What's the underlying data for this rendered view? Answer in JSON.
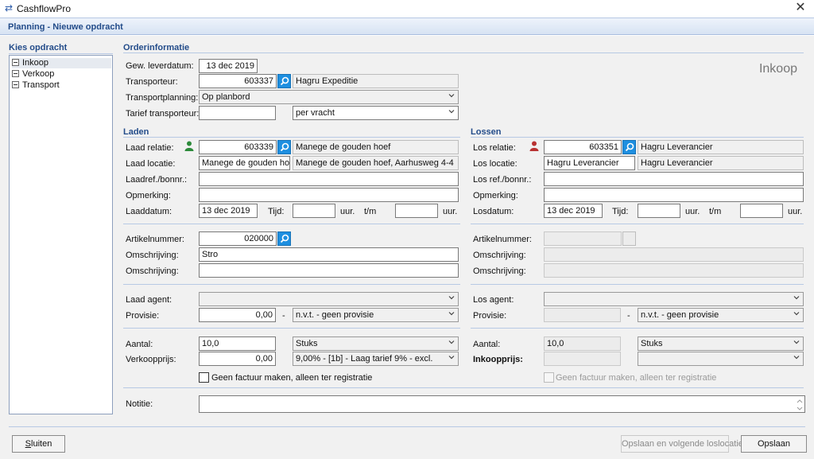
{
  "window": {
    "title": "CashflowPro",
    "subtitle": "Planning - Nieuwe opdracht"
  },
  "sidebar": {
    "title": "Kies opdracht",
    "items": [
      "Inkoop",
      "Verkoop",
      "Transport"
    ]
  },
  "order": {
    "title": "Orderinformatie",
    "type_label": "Inkoop",
    "leverdatum_label": "Gew. leverdatum:",
    "leverdatum": "13 dec 2019",
    "transporteur_label": "Transporteur:",
    "transporteur_code": "603337",
    "transporteur_naam": "Hagru Expeditie",
    "transportplanning_label": "Transportplanning:",
    "transportplanning": "Op planbord",
    "tarief_label": "Tarief transporteur:",
    "tarief_type": "per vracht"
  },
  "laden": {
    "title": "Laden",
    "relatie_label": "Laad relatie:",
    "relatie_code": "603339",
    "relatie_naam": "Manege de gouden hoef",
    "locatie_label": "Laad locatie:",
    "locatie": "Manege de gouden hoef",
    "locatie_adres": "Manege de gouden hoef, Aarhusweg 4-4",
    "ref_label": "Laadref./bonnr.:",
    "opmerking_label": "Opmerking:",
    "datum_label": "Laaddatum:",
    "datum": "13 dec 2019",
    "tijd_label": "Tijd:",
    "uur_label": "uur.",
    "tm_label": "t/m"
  },
  "lossen": {
    "title": "Lossen",
    "relatie_label": "Los relatie:",
    "relatie_code": "603351",
    "relatie_naam": "Hagru Leverancier",
    "locatie_label": "Los locatie:",
    "locatie": "Hagru Leverancier",
    "locatie_adres": "Hagru Leverancier",
    "ref_label": "Los ref./bonnr.:",
    "opmerking_label": "Opmerking:",
    "datum_label": "Losdatum:",
    "datum": "13 dec 2019",
    "tijd_label": "Tijd:",
    "uur_label": "uur.",
    "tm_label": "t/m"
  },
  "artikel": {
    "nummer_label": "Artikelnummer:",
    "nummer": "020000",
    "omschrijving_label": "Omschrijving:",
    "omschrijving": "Stro"
  },
  "agent": {
    "laad_label": "Laad agent:",
    "los_label": "Los agent:",
    "provisie_label": "Provisie:",
    "laad_provisie": "0,00",
    "dash": "-",
    "laad_provisie_type": "n.v.t. - geen provisie",
    "los_provisie_type": "n.v.t. - geen provisie"
  },
  "prijs": {
    "aantal_label": "Aantal:",
    "aantal": "10,0",
    "eenheid": "Stuks",
    "verkoopprijs_label": "Verkoopprijs:",
    "verkoopprijs": "0,00",
    "btw": "9,00% - [1b] - Laag tarief 9% - excl.",
    "inkoopprijs_label": "Inkoopprijs:",
    "geen_factuur_label": "Geen factuur maken, alleen ter registratie"
  },
  "notitie": {
    "label": "Notitie:"
  },
  "footer": {
    "sluiten_first": "S",
    "sluiten_rest": "luiten",
    "opslaan_volgende": "Opslaan en volgende loslocatie",
    "opslaan": "Opslaan"
  },
  "colors": {
    "header_text": "#234c8a",
    "search_button": "#1e8fe0",
    "laad_person": "#2c8a3a",
    "los_person": "#b83232"
  }
}
